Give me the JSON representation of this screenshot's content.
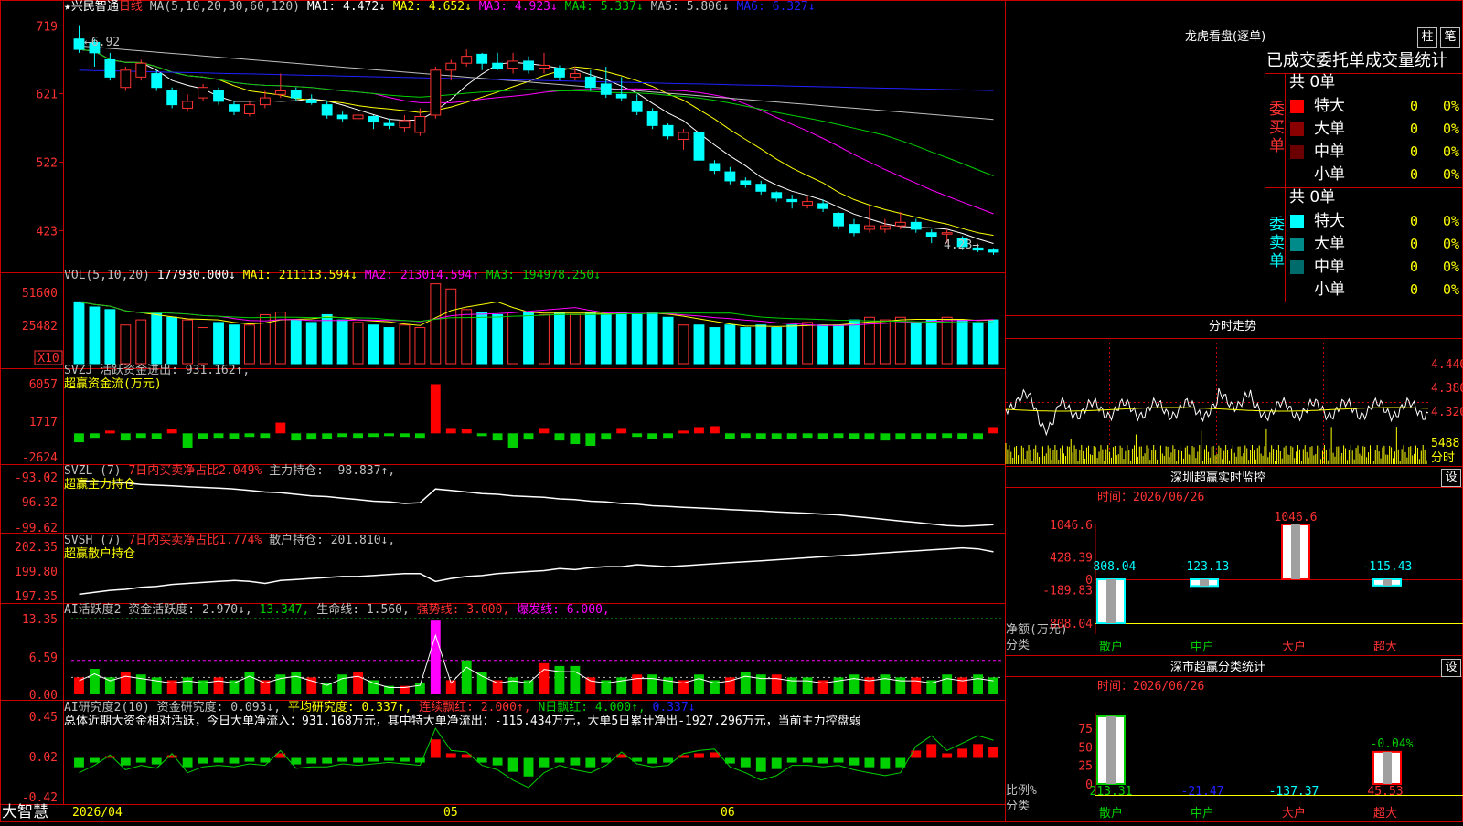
{
  "colors": {
    "up": "#ff3232",
    "down": "#00ffff",
    "white": "#ffffff",
    "yellow": "#ffff00",
    "magenta": "#ff00ff",
    "green": "#00d000",
    "blue": "#2020ff",
    "gray": "#c0c0c0",
    "grid": "#c80000"
  },
  "main": {
    "stock_name": "兴民智通",
    "period": "日线",
    "ma_legend": [
      {
        "label": "MA(5,10,20,30,60,120)",
        "color": "#c0c0c0"
      },
      {
        "label": "MA1: 4.472↓",
        "color": "#ffffff"
      },
      {
        "label": "MA2: 4.652↓",
        "color": "#ffff00"
      },
      {
        "label": "MA3: 4.923↓",
        "color": "#ff00ff"
      },
      {
        "label": "MA4: 5.337↓",
        "color": "#00d000"
      },
      {
        "label": "MA5: 5.806↓",
        "color": "#c0c0c0"
      },
      {
        "label": "MA6: 6.327↓",
        "color": "#2020ff"
      }
    ],
    "y_ticks": [
      "719",
      "621",
      "522",
      "423"
    ],
    "high_label": "6.92",
    "low_label": "4.23"
  },
  "vol": {
    "legend": [
      {
        "label": "VOL(5,10,20)",
        "color": "#c0c0c0"
      },
      {
        "label": "177930.000↓",
        "color": "#ffffff"
      },
      {
        "label": "MA1: 211113.594↓",
        "color": "#ffff00"
      },
      {
        "label": "MA2: 213014.594↑",
        "color": "#ff00ff"
      },
      {
        "label": "MA3: 194978.250↓",
        "color": "#00d000"
      }
    ],
    "y_ticks": [
      "51600",
      "25482"
    ],
    "unit": "X10"
  },
  "svzj": {
    "legend": [
      {
        "label": "SVZJ  活跃资金进出: 931.162↑,",
        "color": "#c0c0c0"
      }
    ],
    "subtitle": "超赢资金流(万元)",
    "y_ticks": [
      "6057",
      "1717",
      "-2624"
    ]
  },
  "svzl": {
    "legend": [
      {
        "label": "SVZL (7) ",
        "color": "#c0c0c0"
      },
      {
        "label": "7日内买卖净占比2.049%",
        "color": "#ff3232"
      },
      {
        "label": " 主力持仓: -98.837↑,",
        "color": "#c0c0c0"
      }
    ],
    "subtitle": "超赢主力持仓",
    "y_ticks": [
      "-93.02",
      "-96.32",
      "-99.62"
    ]
  },
  "svsh": {
    "legend": [
      {
        "label": "SVSH (7) ",
        "color": "#c0c0c0"
      },
      {
        "label": "7日内买卖净占比1.774%",
        "color": "#ff3232"
      },
      {
        "label": " 散户持仓: 201.810↓,",
        "color": "#c0c0c0"
      }
    ],
    "subtitle": "超赢散户持仓",
    "y_ticks": [
      "202.35",
      "199.80",
      "197.35"
    ]
  },
  "ai1": {
    "legend": [
      {
        "label": "AI活跃度2 资金活跃度: 2.970↓,",
        "color": "#c0c0c0"
      },
      {
        "label": "13.347,",
        "color": "#00d000"
      },
      {
        "label": "生命线: 1.560,",
        "color": "#c0c0c0"
      },
      {
        "label": "强势线: 3.000,",
        "color": "#ff3232"
      },
      {
        "label": "爆发线: 6.000,",
        "color": "#ff00ff"
      }
    ],
    "y_ticks": [
      "13.35",
      "6.59",
      "0.00"
    ]
  },
  "ai2": {
    "legend": [
      {
        "label": "AI研究度2(10) 资金研究度: 0.093↓,",
        "color": "#c0c0c0"
      },
      {
        "label": "平均研究度: 0.337↑,",
        "color": "#ffff00"
      },
      {
        "label": "连续飘红: 2.000↑,",
        "color": "#ff3232"
      },
      {
        "label": "N日飘红: 4.000↑,",
        "color": "#00d000"
      },
      {
        "label": "0.337↓",
        "color": "#2020ff"
      }
    ],
    "summary": "总体近期大资金相对活跃，今日大单净流入：931.168万元，其中特大单净流出：-115.434万元，大单5日累计净出-1927.296万元，当前主力控盘弱",
    "y_ticks": [
      "0.45",
      "0.02",
      "-0.42"
    ]
  },
  "bottom": {
    "brand": "大智慧",
    "dates": [
      "2026/04",
      "05",
      "06"
    ]
  },
  "lhb": {
    "title": "龙虎看盘(逐单)",
    "btn_bar": "柱",
    "btn_pen": "笔",
    "tabs": "已成交委托单成交量统计",
    "buy_label": "委买单",
    "sell_label": "委卖单",
    "total_label": "共 0单",
    "rows": [
      {
        "label": "特大",
        "val": "0",
        "pct": "0%"
      },
      {
        "label": "大单",
        "val": "0",
        "pct": "0%"
      },
      {
        "label": "中单",
        "val": "0",
        "pct": "0%"
      },
      {
        "label": "小单",
        "val": "0",
        "pct": "0%"
      }
    ],
    "buy_colors": [
      "#ff0000",
      "#8b0000",
      "#6b0000",
      "#000000"
    ],
    "sell_colors": [
      "#00ffff",
      "#008b8b",
      "#006b6b",
      "#000000"
    ]
  },
  "intraday": {
    "title": "分时走势",
    "y_ticks": [
      "4.440",
      "4.380",
      "4.320"
    ],
    "vol_tick": "5488",
    "vol_unit": "分时"
  },
  "sz_monitor": {
    "title": "深圳超赢实时监控",
    "btn": "设",
    "time_label": "时间：2026/06/26",
    "y_ticks": [
      "1046.6",
      "428.39",
      "0",
      "-189.83",
      "-808.04"
    ],
    "unit_label": "净额(万元)",
    "cat_label": "分类",
    "bars": [
      {
        "name": "散户",
        "value": -808.04,
        "label": "-808.04"
      },
      {
        "name": "中户",
        "value": -123.13,
        "label": "-123.13"
      },
      {
        "name": "大户",
        "value": 1046.6,
        "label": "1046.6"
      },
      {
        "name": "超大",
        "value": -115.43,
        "label": "-115.43"
      }
    ]
  },
  "sz_stats": {
    "title": "深市超赢分类统计",
    "btn": "设",
    "time_label": "时间：2026/06/26",
    "y_ticks": [
      "75",
      "50",
      "25",
      "0"
    ],
    "unit_label": "比例%",
    "cat_label": "分类",
    "top_label": "-0.04%",
    "bars": [
      {
        "name": "散户",
        "value": 213.31,
        "label": "213.31",
        "pct": 95
      },
      {
        "name": "中户",
        "value": -21.47,
        "label": "-21.47",
        "pct": 0
      },
      {
        "name": "大户",
        "value": -137.37,
        "label": "-137.37",
        "pct": 0
      },
      {
        "name": "超大",
        "value": 45.53,
        "label": "45.53",
        "pct": 45
      }
    ]
  },
  "chart_data": {
    "type": "candlestick",
    "title": "兴民智通 日线",
    "ylim": [
      4.23,
      7.2
    ],
    "candles": [
      [
        7.0,
        6.85,
        7.2,
        6.8
      ],
      [
        6.95,
        6.8,
        7.0,
        6.6
      ],
      [
        6.7,
        6.45,
        6.8,
        6.4
      ],
      [
        6.3,
        6.55,
        6.6,
        6.25
      ],
      [
        6.45,
        6.65,
        6.7,
        6.4
      ],
      [
        6.5,
        6.3,
        6.55,
        6.25
      ],
      [
        6.25,
        6.05,
        6.3,
        6.0
      ],
      [
        6.0,
        6.1,
        6.2,
        5.95
      ],
      [
        6.15,
        6.3,
        6.35,
        6.1
      ],
      [
        6.25,
        6.1,
        6.3,
        6.05
      ],
      [
        6.05,
        5.95,
        6.1,
        5.9
      ],
      [
        5.92,
        6.05,
        6.1,
        5.88
      ],
      [
        6.05,
        6.15,
        6.25,
        6.0
      ],
      [
        6.2,
        6.25,
        6.5,
        6.15
      ],
      [
        6.25,
        6.15,
        6.3,
        6.1
      ],
      [
        6.12,
        6.08,
        6.2,
        6.05
      ],
      [
        6.05,
        5.9,
        6.1,
        5.85
      ],
      [
        5.9,
        5.85,
        5.95,
        5.8
      ],
      [
        5.85,
        5.9,
        5.95,
        5.8
      ],
      [
        5.88,
        5.8,
        5.9,
        5.7
      ],
      [
        5.78,
        5.75,
        5.85,
        5.7
      ],
      [
        5.72,
        5.82,
        5.9,
        5.65
      ],
      [
        5.65,
        5.88,
        6.0,
        5.6
      ],
      [
        5.9,
        6.55,
        6.6,
        5.85
      ],
      [
        6.55,
        6.65,
        6.7,
        6.4
      ],
      [
        6.65,
        6.75,
        6.85,
        6.6
      ],
      [
        6.78,
        6.65,
        6.8,
        6.55
      ],
      [
        6.65,
        6.58,
        6.8,
        6.55
      ],
      [
        6.58,
        6.68,
        6.8,
        6.5
      ],
      [
        6.68,
        6.55,
        6.75,
        6.5
      ],
      [
        6.58,
        6.62,
        6.8,
        6.5
      ],
      [
        6.58,
        6.45,
        6.62,
        6.4
      ],
      [
        6.45,
        6.5,
        6.6,
        6.4
      ],
      [
        6.45,
        6.3,
        6.55,
        6.25
      ],
      [
        6.35,
        6.2,
        6.6,
        6.15
      ],
      [
        6.2,
        6.15,
        6.45,
        6.1
      ],
      [
        6.1,
        5.95,
        6.2,
        5.9
      ],
      [
        5.95,
        5.75,
        6.0,
        5.7
      ],
      [
        5.75,
        5.6,
        5.78,
        5.55
      ],
      [
        5.55,
        5.65,
        5.7,
        5.4
      ],
      [
        5.65,
        5.25,
        5.7,
        5.2
      ],
      [
        5.2,
        5.1,
        5.25,
        5.05
      ],
      [
        5.08,
        4.95,
        5.15,
        4.9
      ],
      [
        4.95,
        4.9,
        5.0,
        4.85
      ],
      [
        4.9,
        4.8,
        4.95,
        4.75
      ],
      [
        4.78,
        4.7,
        4.8,
        4.65
      ],
      [
        4.68,
        4.65,
        4.75,
        4.55
      ],
      [
        4.6,
        4.65,
        4.72,
        4.55
      ],
      [
        4.62,
        4.55,
        4.68,
        4.5
      ],
      [
        4.48,
        4.3,
        4.5,
        4.25
      ],
      [
        4.32,
        4.2,
        4.4,
        4.15
      ],
      [
        4.25,
        4.3,
        4.6,
        4.2
      ],
      [
        4.25,
        4.3,
        4.4,
        4.2
      ],
      [
        4.3,
        4.35,
        4.5,
        4.25
      ],
      [
        4.35,
        4.25,
        4.4,
        4.2
      ],
      [
        4.2,
        4.15,
        4.25,
        4.05
      ],
      [
        4.18,
        4.2,
        4.25,
        4.05
      ],
      [
        4.12,
        4.0,
        4.15,
        3.95
      ],
      [
        3.98,
        3.95,
        4.0,
        3.92
      ],
      [
        3.95,
        3.92,
        3.98,
        3.88
      ]
    ],
    "volumes": [
      48,
      44,
      42,
      30,
      34,
      40,
      36,
      34,
      28,
      32,
      30,
      30,
      38,
      40,
      34,
      32,
      38,
      34,
      32,
      30,
      28,
      30,
      28,
      62,
      58,
      42,
      40,
      38,
      40,
      40,
      38,
      40,
      38,
      40,
      38,
      40,
      38,
      40,
      36,
      30,
      30,
      28,
      30,
      28,
      30,
      28,
      30,
      32,
      30,
      30,
      34,
      36,
      34,
      36,
      32,
      34,
      36,
      34,
      32,
      34
    ],
    "svzj": [
      -1,
      -0.5,
      0.3,
      -0.8,
      -0.5,
      -0.6,
      0.5,
      -1.6,
      -0.6,
      -0.5,
      -0.6,
      -0.4,
      -0.5,
      1.2,
      -0.8,
      -0.7,
      -0.6,
      -0.4,
      -0.5,
      -0.4,
      -0.3,
      -0.4,
      -0.5,
      5.5,
      0.6,
      0.5,
      -0.3,
      -0.8,
      -1.6,
      -0.7,
      0.6,
      -0.8,
      -1.2,
      -1.4,
      -0.7,
      0.6,
      -0.4,
      -0.6,
      -0.5,
      0.3,
      0.7,
      0.8,
      -0.6,
      -0.5,
      -0.6,
      -0.6,
      -0.6,
      -0.5,
      -0.6,
      -0.5,
      -0.6,
      -0.7,
      -0.8,
      -0.7,
      -0.6,
      -0.7,
      -0.5,
      -0.6,
      -0.7,
      0.7
    ],
    "svzl": [
      -93.5,
      -93.6,
      -93.7,
      -93.8,
      -94.0,
      -94.1,
      -94.2,
      -94.3,
      -94.4,
      -94.5,
      -94.6,
      -94.8,
      -95.0,
      -95.1,
      -95.3,
      -95.5,
      -95.6,
      -95.8,
      -96.0,
      -96.2,
      -96.3,
      -96.5,
      -96.4,
      -94.6,
      -94.8,
      -95.0,
      -95.2,
      -95.3,
      -95.5,
      -95.6,
      -95.7,
      -95.9,
      -96.0,
      -96.2,
      -96.3,
      -96.5,
      -96.6,
      -96.8,
      -96.9,
      -97.0,
      -97.1,
      -97.2,
      -97.3,
      -97.4,
      -97.5,
      -97.6,
      -97.7,
      -97.8,
      -97.9,
      -98.0,
      -98.2,
      -98.4,
      -98.6,
      -98.8,
      -99.0,
      -99.2,
      -99.4,
      -99.5,
      -99.4,
      -99.3
    ],
    "svsh": [
      197.5,
      197.7,
      197.9,
      198.0,
      198.2,
      198.3,
      198.5,
      198.6,
      198.7,
      198.8,
      198.9,
      198.8,
      198.6,
      198.9,
      199.0,
      199.1,
      199.2,
      199.3,
      199.3,
      199.4,
      199.5,
      199.6,
      199.6,
      198.8,
      199.1,
      199.3,
      199.4,
      199.6,
      199.7,
      199.8,
      199.9,
      200.1,
      200.0,
      200.2,
      200.3,
      200.3,
      200.5,
      200.4,
      200.3,
      200.4,
      200.5,
      200.6,
      200.7,
      200.8,
      200.9,
      201.0,
      201.1,
      201.2,
      201.3,
      201.4,
      201.5,
      201.6,
      201.7,
      201.8,
      201.9,
      202.0,
      202.1,
      202.2,
      202.1,
      201.8
    ],
    "ai1": [
      3,
      4.5,
      3,
      4,
      3.5,
      3,
      2.5,
      3,
      2.5,
      3,
      2.5,
      4,
      2.5,
      3.5,
      4,
      3,
      2,
      3.5,
      4,
      2.5,
      1.5,
      1.5,
      2,
      13,
      2.5,
      6,
      4,
      2.5,
      3,
      2.5,
      5.5,
      5,
      5,
      3,
      2.5,
      3,
      3.5,
      3.5,
      3,
      2.5,
      3.5,
      2.5,
      3,
      4,
      3.5,
      3.5,
      3,
      3,
      2.5,
      3,
      3.5,
      3,
      3.5,
      3,
      3,
      2.5,
      3.5,
      3,
      3.5,
      3
    ],
    "ai2": [
      -0.1,
      -0.05,
      0.02,
      -0.08,
      -0.05,
      -0.07,
      0.03,
      -0.1,
      -0.06,
      -0.05,
      -0.06,
      -0.04,
      -0.05,
      0.05,
      -0.07,
      -0.06,
      -0.06,
      -0.04,
      -0.05,
      -0.04,
      -0.03,
      -0.04,
      -0.05,
      0.2,
      0.05,
      0.04,
      -0.05,
      -0.08,
      -0.15,
      -0.2,
      -0.1,
      -0.05,
      -0.08,
      -0.1,
      -0.05,
      0.04,
      -0.04,
      -0.06,
      -0.05,
      0.03,
      0.05,
      0.06,
      -0.06,
      -0.1,
      -0.15,
      -0.12,
      -0.05,
      -0.05,
      -0.06,
      -0.05,
      -0.08,
      -0.1,
      -0.12,
      -0.1,
      0.08,
      0.15,
      0.05,
      0.1,
      0.15,
      0.12
    ]
  }
}
